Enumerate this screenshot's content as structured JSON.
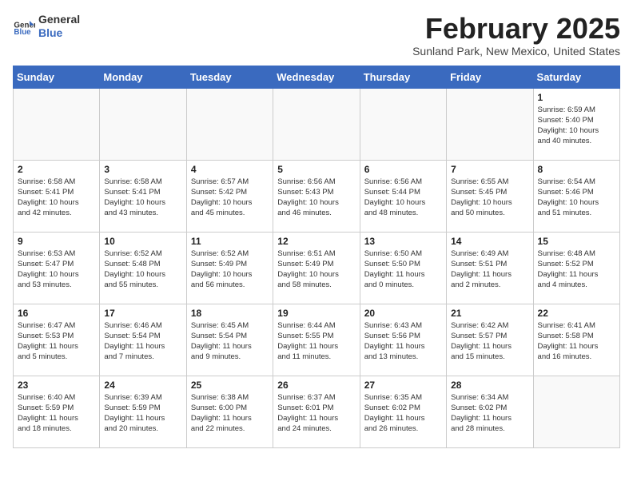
{
  "header": {
    "logo_general": "General",
    "logo_blue": "Blue",
    "month_title": "February 2025",
    "subtitle": "Sunland Park, New Mexico, United States"
  },
  "weekdays": [
    "Sunday",
    "Monday",
    "Tuesday",
    "Wednesday",
    "Thursday",
    "Friday",
    "Saturday"
  ],
  "weeks": [
    [
      {
        "day": "",
        "info": ""
      },
      {
        "day": "",
        "info": ""
      },
      {
        "day": "",
        "info": ""
      },
      {
        "day": "",
        "info": ""
      },
      {
        "day": "",
        "info": ""
      },
      {
        "day": "",
        "info": ""
      },
      {
        "day": "1",
        "info": "Sunrise: 6:59 AM\nSunset: 5:40 PM\nDaylight: 10 hours\nand 40 minutes."
      }
    ],
    [
      {
        "day": "2",
        "info": "Sunrise: 6:58 AM\nSunset: 5:41 PM\nDaylight: 10 hours\nand 42 minutes."
      },
      {
        "day": "3",
        "info": "Sunrise: 6:58 AM\nSunset: 5:41 PM\nDaylight: 10 hours\nand 43 minutes."
      },
      {
        "day": "4",
        "info": "Sunrise: 6:57 AM\nSunset: 5:42 PM\nDaylight: 10 hours\nand 45 minutes."
      },
      {
        "day": "5",
        "info": "Sunrise: 6:56 AM\nSunset: 5:43 PM\nDaylight: 10 hours\nand 46 minutes."
      },
      {
        "day": "6",
        "info": "Sunrise: 6:56 AM\nSunset: 5:44 PM\nDaylight: 10 hours\nand 48 minutes."
      },
      {
        "day": "7",
        "info": "Sunrise: 6:55 AM\nSunset: 5:45 PM\nDaylight: 10 hours\nand 50 minutes."
      },
      {
        "day": "8",
        "info": "Sunrise: 6:54 AM\nSunset: 5:46 PM\nDaylight: 10 hours\nand 51 minutes."
      }
    ],
    [
      {
        "day": "9",
        "info": "Sunrise: 6:53 AM\nSunset: 5:47 PM\nDaylight: 10 hours\nand 53 minutes."
      },
      {
        "day": "10",
        "info": "Sunrise: 6:52 AM\nSunset: 5:48 PM\nDaylight: 10 hours\nand 55 minutes."
      },
      {
        "day": "11",
        "info": "Sunrise: 6:52 AM\nSunset: 5:49 PM\nDaylight: 10 hours\nand 56 minutes."
      },
      {
        "day": "12",
        "info": "Sunrise: 6:51 AM\nSunset: 5:49 PM\nDaylight: 10 hours\nand 58 minutes."
      },
      {
        "day": "13",
        "info": "Sunrise: 6:50 AM\nSunset: 5:50 PM\nDaylight: 11 hours\nand 0 minutes."
      },
      {
        "day": "14",
        "info": "Sunrise: 6:49 AM\nSunset: 5:51 PM\nDaylight: 11 hours\nand 2 minutes."
      },
      {
        "day": "15",
        "info": "Sunrise: 6:48 AM\nSunset: 5:52 PM\nDaylight: 11 hours\nand 4 minutes."
      }
    ],
    [
      {
        "day": "16",
        "info": "Sunrise: 6:47 AM\nSunset: 5:53 PM\nDaylight: 11 hours\nand 5 minutes."
      },
      {
        "day": "17",
        "info": "Sunrise: 6:46 AM\nSunset: 5:54 PM\nDaylight: 11 hours\nand 7 minutes."
      },
      {
        "day": "18",
        "info": "Sunrise: 6:45 AM\nSunset: 5:54 PM\nDaylight: 11 hours\nand 9 minutes."
      },
      {
        "day": "19",
        "info": "Sunrise: 6:44 AM\nSunset: 5:55 PM\nDaylight: 11 hours\nand 11 minutes."
      },
      {
        "day": "20",
        "info": "Sunrise: 6:43 AM\nSunset: 5:56 PM\nDaylight: 11 hours\nand 13 minutes."
      },
      {
        "day": "21",
        "info": "Sunrise: 6:42 AM\nSunset: 5:57 PM\nDaylight: 11 hours\nand 15 minutes."
      },
      {
        "day": "22",
        "info": "Sunrise: 6:41 AM\nSunset: 5:58 PM\nDaylight: 11 hours\nand 16 minutes."
      }
    ],
    [
      {
        "day": "23",
        "info": "Sunrise: 6:40 AM\nSunset: 5:59 PM\nDaylight: 11 hours\nand 18 minutes."
      },
      {
        "day": "24",
        "info": "Sunrise: 6:39 AM\nSunset: 5:59 PM\nDaylight: 11 hours\nand 20 minutes."
      },
      {
        "day": "25",
        "info": "Sunrise: 6:38 AM\nSunset: 6:00 PM\nDaylight: 11 hours\nand 22 minutes."
      },
      {
        "day": "26",
        "info": "Sunrise: 6:37 AM\nSunset: 6:01 PM\nDaylight: 11 hours\nand 24 minutes."
      },
      {
        "day": "27",
        "info": "Sunrise: 6:35 AM\nSunset: 6:02 PM\nDaylight: 11 hours\nand 26 minutes."
      },
      {
        "day": "28",
        "info": "Sunrise: 6:34 AM\nSunset: 6:02 PM\nDaylight: 11 hours\nand 28 minutes."
      },
      {
        "day": "",
        "info": ""
      }
    ]
  ]
}
